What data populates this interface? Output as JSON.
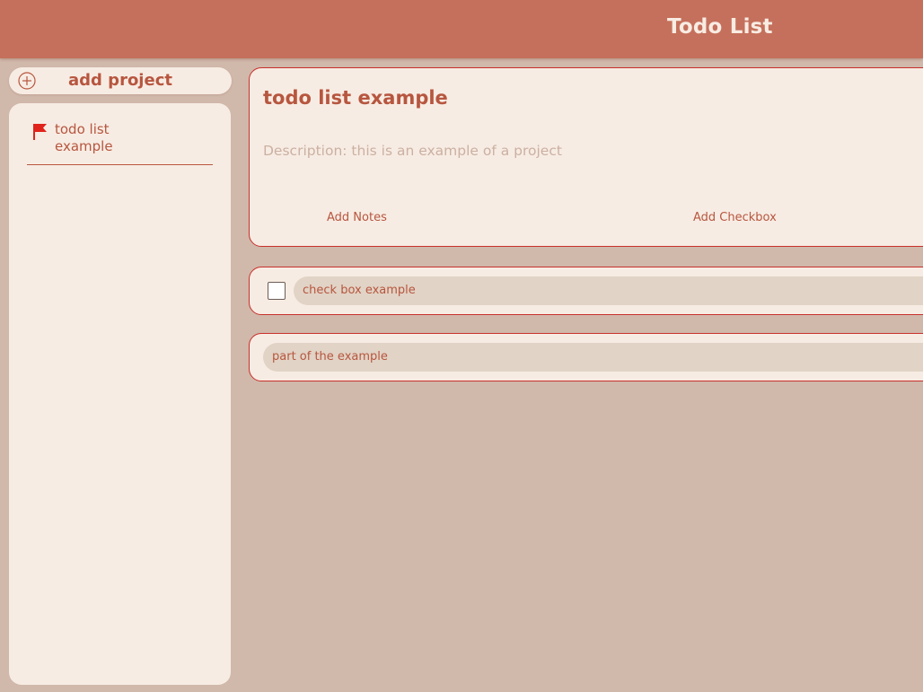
{
  "header": {
    "title": "Todo List"
  },
  "sidebar": {
    "add_project_label": "add project",
    "projects": [
      {
        "label": "todo list example",
        "icon": "flag-icon"
      }
    ]
  },
  "project": {
    "title": "todo list example",
    "description": "Description: this is an example of a project",
    "actions": {
      "add_notes": "Add Notes",
      "add_checkbox": "Add Checkbox"
    }
  },
  "items": {
    "checkbox_item": {
      "text": "check box example",
      "checked": false
    },
    "note_item": {
      "text": "part of the example"
    }
  },
  "colors": {
    "header_bg": "#c5705c",
    "page_bg": "#d0b8aa",
    "card_bg": "#f7ece3",
    "accent_text": "#b7563f",
    "card_border": "#c9302c",
    "flag": "#e0231b"
  }
}
